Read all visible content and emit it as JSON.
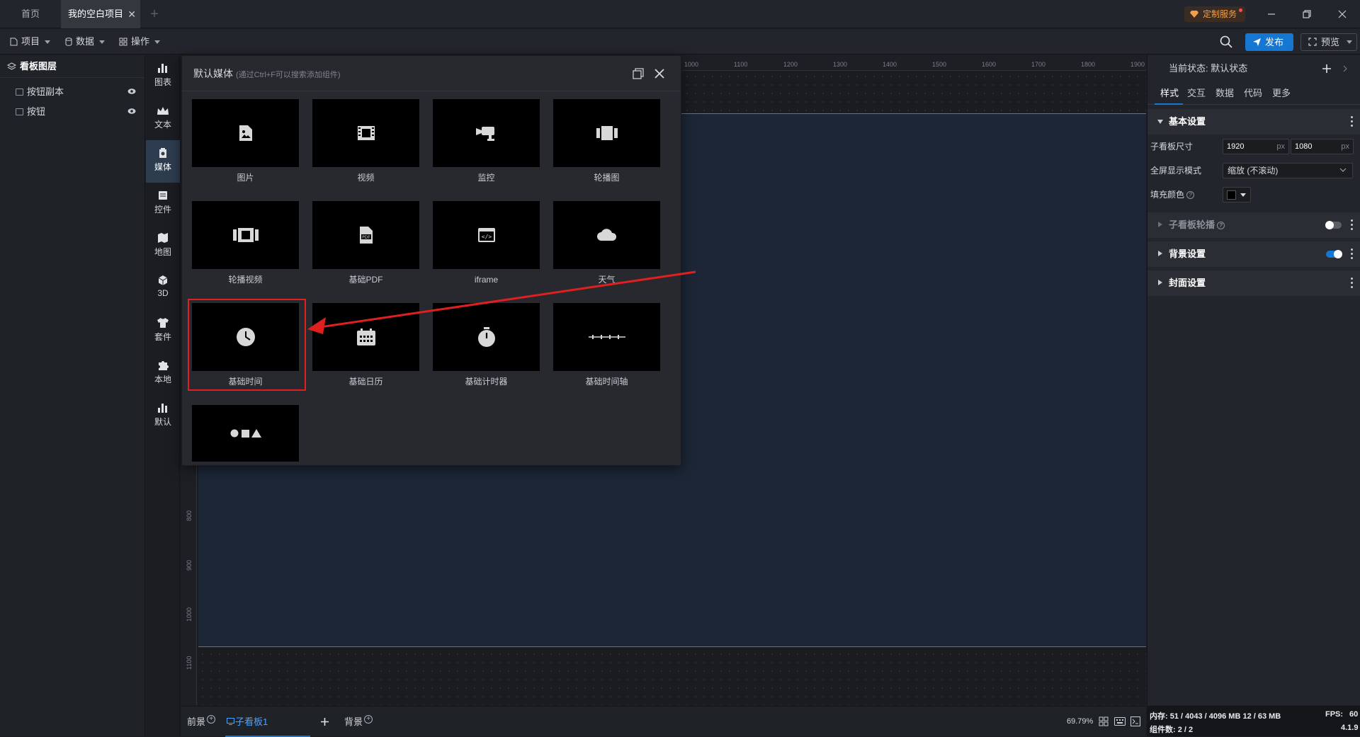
{
  "window": {
    "tabs": [
      {
        "label": "首页"
      },
      {
        "label": "我的空白项目"
      }
    ],
    "custom_service": "定制服务"
  },
  "toolbar": {
    "menus": [
      {
        "label": "项目"
      },
      {
        "label": "数据"
      },
      {
        "label": "操作"
      }
    ],
    "publish_label": "发布",
    "preview_label": "预览"
  },
  "layers": {
    "title": "看板图层",
    "items": [
      {
        "label": "按钮副本"
      },
      {
        "label": "按钮"
      }
    ]
  },
  "sidebar": {
    "items": [
      {
        "label": "图表",
        "icon": "bar-chart-icon"
      },
      {
        "label": "文本",
        "icon": "text-crown-icon"
      },
      {
        "label": "媒体",
        "icon": "media-icon",
        "active": true
      },
      {
        "label": "控件",
        "icon": "control-icon"
      },
      {
        "label": "地图",
        "icon": "map-icon"
      },
      {
        "label": "3D",
        "icon": "cube-icon"
      },
      {
        "label": "套件",
        "icon": "shirt-icon"
      },
      {
        "label": "本地",
        "icon": "puzzle-icon"
      },
      {
        "label": "默认",
        "icon": "bar-chart-icon"
      }
    ]
  },
  "ruler": {
    "top_ticks": [
      "1000",
      "1100",
      "1200",
      "1300",
      "1400",
      "1500",
      "1600",
      "1700",
      "1800",
      "1900"
    ],
    "left_ticks": [
      "800",
      "900",
      "1000",
      "1100"
    ]
  },
  "media_panel": {
    "title": "默认媒体",
    "hint": "(通过Ctrl+F可以搜索添加组件)",
    "items": [
      {
        "label": "图片",
        "icon": "image-file-icon"
      },
      {
        "label": "视频",
        "icon": "film-icon"
      },
      {
        "label": "监控",
        "icon": "cctv-camera-icon"
      },
      {
        "label": "轮播图",
        "icon": "carousel-icon"
      },
      {
        "label": "轮播视频",
        "icon": "film-strip-icon"
      },
      {
        "label": "基础PDF",
        "icon": "pdf-file-icon"
      },
      {
        "label": "iframe",
        "icon": "code-window-icon"
      },
      {
        "label": "天气",
        "icon": "cloud-icon"
      },
      {
        "label": "基础时间",
        "icon": "clock-icon"
      },
      {
        "label": "基础日历",
        "icon": "calendar-icon"
      },
      {
        "label": "基础计时器",
        "icon": "stopwatch-icon"
      },
      {
        "label": "基础时间轴",
        "icon": "timeline-icon"
      },
      {
        "label": "",
        "icon": "shapes-icon"
      }
    ]
  },
  "right_panel": {
    "state_label": "当前状态:",
    "state_value": "默认状态",
    "tabs": [
      {
        "label": "样式"
      },
      {
        "label": "交互"
      },
      {
        "label": "数据"
      },
      {
        "label": "代码"
      },
      {
        "label": "更多"
      }
    ],
    "basic_section": "基本设置",
    "size_label": "子看板尺寸",
    "width": "1920",
    "height": "1080",
    "unit": "px",
    "fullscreen_label": "全屏显示模式",
    "fullscreen_value": "缩放 (不滚动)",
    "fill_label": "填充颜色",
    "fill_color": "#000000",
    "carousel_section": "子看板轮播",
    "carousel_enabled": false,
    "bg_section": "背景设置",
    "bg_enabled": true,
    "cover_section": "封面设置"
  },
  "bottom_bar": {
    "foreground": "前景",
    "sub_board": "子看板1",
    "background": "背景",
    "zoom": "69.79%"
  },
  "status": {
    "memory": "内存:  51 / 4043 / 4096 MB  12 / 63 MB",
    "fps_label": "FPS:",
    "fps": "60",
    "components": "组件数: 2 / 2",
    "version": "4.1.9"
  },
  "colors": {
    "accent": "#1677d2",
    "highlight": "#e02020",
    "artboard": "#1c2636"
  }
}
